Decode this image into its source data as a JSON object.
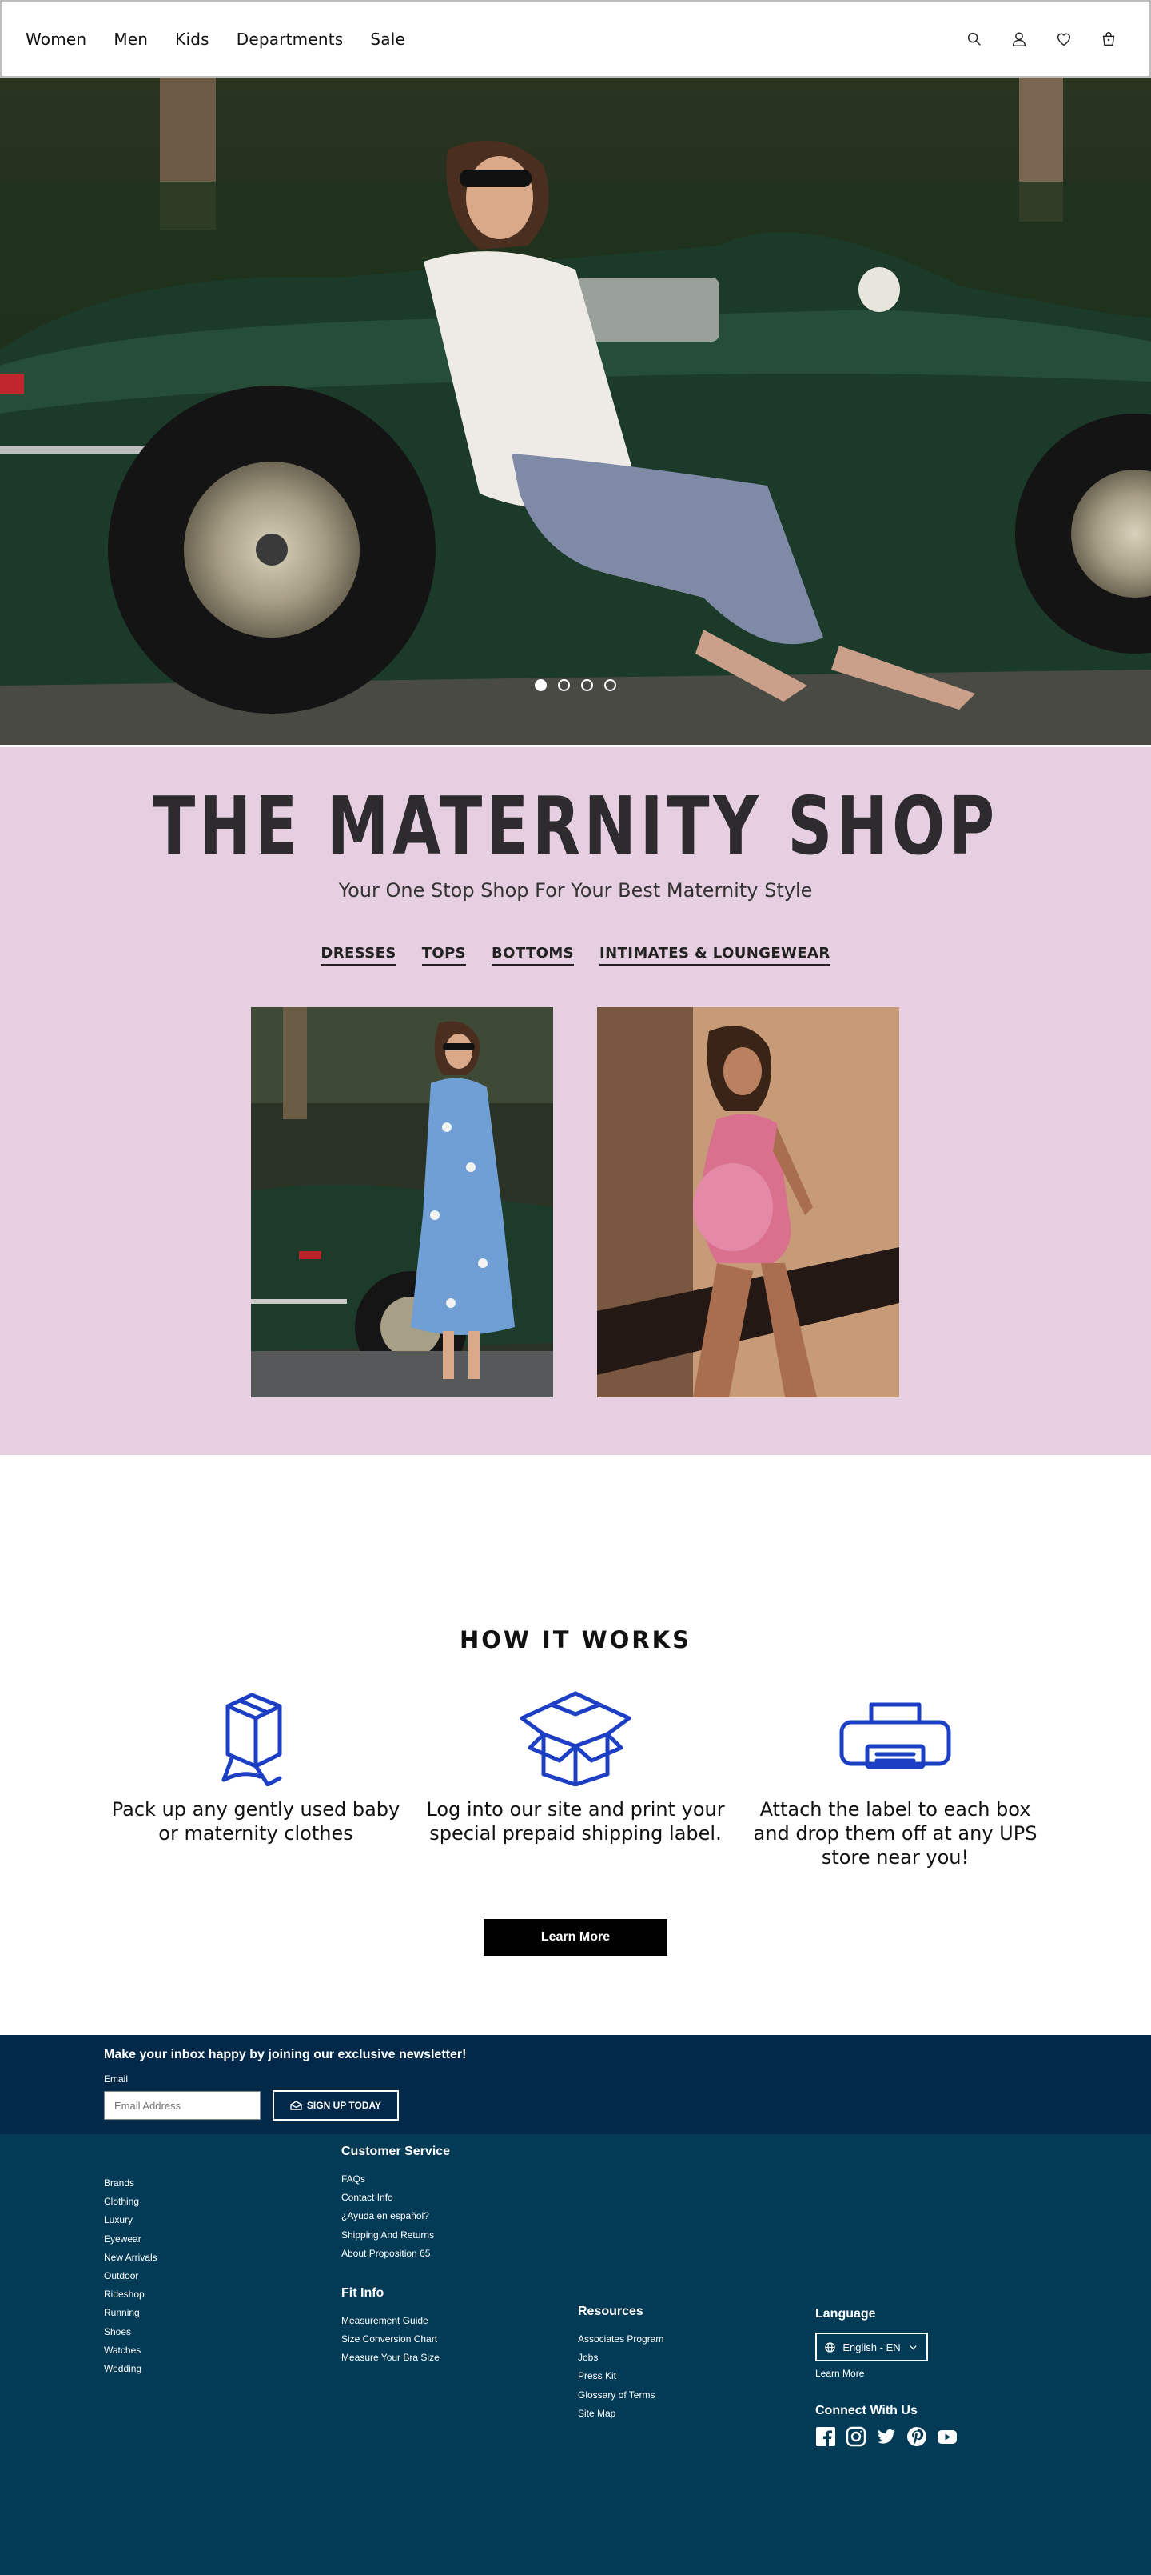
{
  "header": {
    "nav": [
      "Women",
      "Men",
      "Kids",
      "Departments",
      "Sale"
    ],
    "icons": [
      "search-icon",
      "account-icon",
      "heart-icon",
      "bag-icon"
    ]
  },
  "hero": {
    "carousel_dots": 4,
    "active_dot": 0
  },
  "maternity": {
    "title": "THE MATERNITY SHOP",
    "subtitle": "Your One Stop Shop For Your Best Maternity Style",
    "categories": [
      "DRESSES",
      "TOPS",
      "BOTTOMS",
      "INTIMATES & LOUNGEWEAR"
    ],
    "background": "#e5cfe0"
  },
  "how_it_works": {
    "title": "HOW IT WORKS",
    "steps": [
      {
        "icon": "package-icon",
        "text": "Pack up any gently used baby or maternity clothes"
      },
      {
        "icon": "open-box-icon",
        "text": "Log into our site and print your special prepaid shipping label."
      },
      {
        "icon": "printer-icon",
        "text": "Attach the label to each box and drop them off at any UPS store near you!"
      }
    ],
    "button": "Learn More",
    "accent": "#1d3fc4"
  },
  "newsletter": {
    "heading": "Make your inbox happy by joining our exclusive newsletter!",
    "email_label": "Email",
    "email_placeholder": "Email Address",
    "button": "SIGN UP TODAY"
  },
  "footer": {
    "brands": [
      "Brands",
      "Clothing",
      "Luxury",
      "Eyewear",
      "New Arrivals",
      "Outdoor",
      "Rideshop",
      "Running",
      "Shoes",
      "Watches",
      "Wedding"
    ],
    "customer_service": {
      "title": "Customer Service",
      "links": [
        "FAQs",
        "Contact Info",
        "¿Ayuda en español?",
        "Shipping And Returns",
        "About Proposition 65"
      ]
    },
    "fit_info": {
      "title": "Fit Info",
      "links": [
        "Measurement Guide",
        "Size Conversion Chart",
        "Measure Your Bra Size"
      ]
    },
    "resources": {
      "title": "Resources",
      "links": [
        "Associates Program",
        "Jobs",
        "Press Kit",
        "Glossary of Terms",
        "Site Map"
      ]
    },
    "language": {
      "title": "Language",
      "selected": "English - EN",
      "learn_more": "Learn More"
    },
    "connect": {
      "title": "Connect With Us",
      "icons": [
        "facebook-icon",
        "instagram-icon",
        "twitter-icon",
        "pinterest-icon",
        "youtube-icon"
      ]
    },
    "colors": {
      "newsletter_bg": "#03294a",
      "footer_bg": "#033a55"
    }
  }
}
